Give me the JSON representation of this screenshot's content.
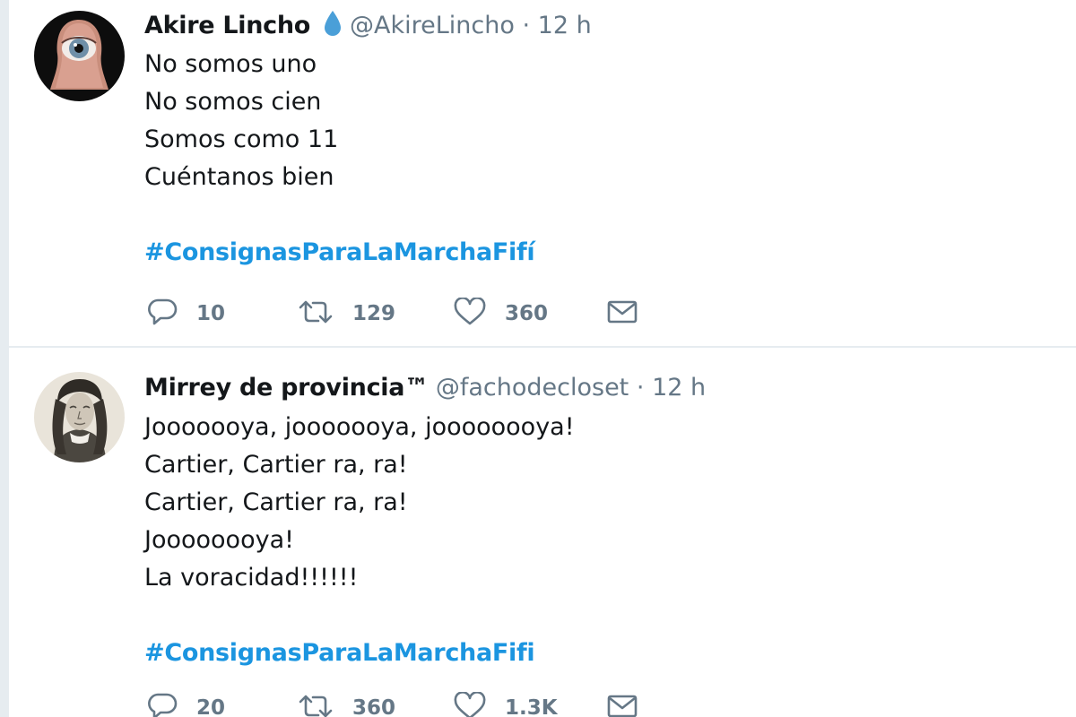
{
  "tweets": [
    {
      "name": "Akire Lincho",
      "handle": "@AkireLincho",
      "separator": "·",
      "time": "12 h",
      "badge_icon": "water-drop-icon",
      "lines": [
        "No somos uno",
        "No somos cien",
        "Somos como 11",
        "Cuéntanos bien"
      ],
      "hashtag": "#ConsignasParaLaMarchaFifí",
      "replies": "10",
      "retweets": "129",
      "likes": "360"
    },
    {
      "name": "Mirrey de provincia™",
      "handle": "@fachodecloset",
      "separator": "·",
      "time": "12 h",
      "lines": [
        "Jooooooya, jooooooya, joooooooya!",
        "Cartier, Cartier ra, ra!",
        "Cartier, Cartier ra, ra!",
        "Joooooooya!",
        "La voracidad!!!!!!"
      ],
      "hashtag": "#ConsignasParaLaMarchaFifi",
      "replies": "20",
      "retweets": "360",
      "likes": "1.3K"
    }
  ],
  "icons": {
    "reply": "reply-icon",
    "retweet": "retweet-icon",
    "like": "heart-icon",
    "message": "envelope-icon"
  },
  "colors": {
    "text": "#14171a",
    "muted": "#657786",
    "hashtag": "#1b95e0",
    "verified_drop": "#4a9fd8",
    "divider": "#e6ecf0"
  }
}
